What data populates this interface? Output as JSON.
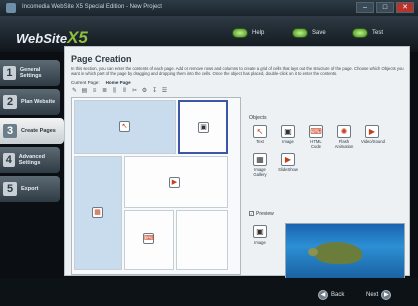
{
  "window": {
    "title": "Incomedia WebSite X5 Special Edition - New Project",
    "minimize": "–",
    "maximize": "□",
    "close": "✕"
  },
  "header": {
    "logo_text": "WebSite",
    "logo_x": "X5",
    "help_label": "Help",
    "save_label": "Save",
    "test_label": "Test"
  },
  "nav": {
    "items": [
      {
        "num": "1",
        "label": "General Settings"
      },
      {
        "num": "2",
        "label": "Plan Website"
      },
      {
        "num": "3",
        "label": "Create Pages"
      },
      {
        "num": "4",
        "label": "Advanced Settings"
      },
      {
        "num": "5",
        "label": "Export"
      }
    ]
  },
  "main": {
    "title": "Page Creation",
    "description": "In this section, you can enter the contents of each page. Add or remove rows and columns to create a grid of cells that lays out the structure of the page. Choose which Objects you want in which part of the page by dragging and dropping them into the cells. Once the object has placed, double-click on it to enter the contents.",
    "current_page_label": "Current Page:",
    "current_page_value": "Home Page"
  },
  "objects": {
    "title": "Objects",
    "items": [
      {
        "label": "Text",
        "icon": "text-icon"
      },
      {
        "label": "Image",
        "icon": "image-icon"
      },
      {
        "label": "HTML Code",
        "icon": "html-code-icon"
      },
      {
        "label": "Flash Animation",
        "icon": "flash-icon"
      },
      {
        "label": "Video/Sound",
        "icon": "video-sound-icon"
      },
      {
        "label": "Image Gallery",
        "icon": "gallery-icon"
      },
      {
        "label": "SlideShow",
        "icon": "slideshow-icon"
      }
    ]
  },
  "preview": {
    "checkbox_label": "Preview",
    "checked": true,
    "object_label": "Image"
  },
  "footer": {
    "back_label": "Back",
    "next_label": "Next"
  }
}
